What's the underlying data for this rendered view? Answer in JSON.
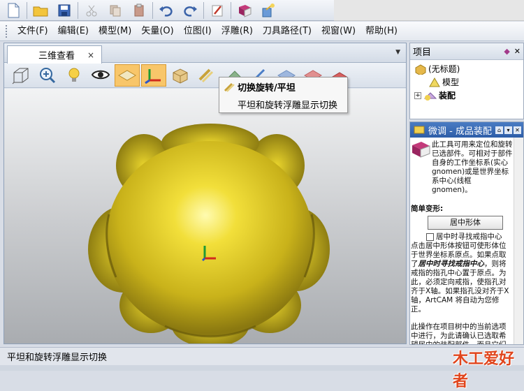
{
  "menu": [
    "文件(F)",
    "编辑(E)",
    "模型(M)",
    "矢量(O)",
    "位图(I)",
    "浮雕(R)",
    "刀具路径(T)",
    "视窗(W)",
    "帮助(H)"
  ],
  "doc": {
    "tab_label": "三维查看",
    "close": "×",
    "dropdown": "▼"
  },
  "tooltip": {
    "title": "切换旋转/平坦",
    "body": "平坦和旋转浮雕显示切换"
  },
  "project": {
    "title": "项目",
    "tree": [
      {
        "label": "(无标题)"
      },
      {
        "label": "模型"
      },
      {
        "label": "装配"
      }
    ]
  },
  "tweak": {
    "title": "微调 - 成品装配",
    "intro": "此工具可用来定位和旋转已选部件。可相对于部件自身的工作坐标系(实心 gnomen)或是世界坐标系中心(线框 gnomen)。",
    "section": "简单变形:",
    "center_button": "居中形体",
    "checkbox_label": "居中时寻找戒指中心",
    "desc1": "点击居中形体按钮可使形体位于世界坐标系原点。如果点取了",
    "desc_bold": "居中时寻找戒指中心",
    "desc2": "，则将戒指的指孔中心置于原点。为此，必须定向戒指，使指孔对齐于X轴。如果指孔没对齐于X轴，ArtCAM 将自动为您修正。",
    "desc3": "此操作在项目树中的当前选项中进行，为此请确认已选取希望居中的装配部件，而且它们已"
  },
  "status": {
    "text": "平坦和旋转浮雕显示切换"
  },
  "watermark": {
    "text": "木工爱好者"
  },
  "colors": {
    "relief": "#e8d22a",
    "tweak_header": "#3566b0",
    "active_tool": "#f8c66a"
  }
}
